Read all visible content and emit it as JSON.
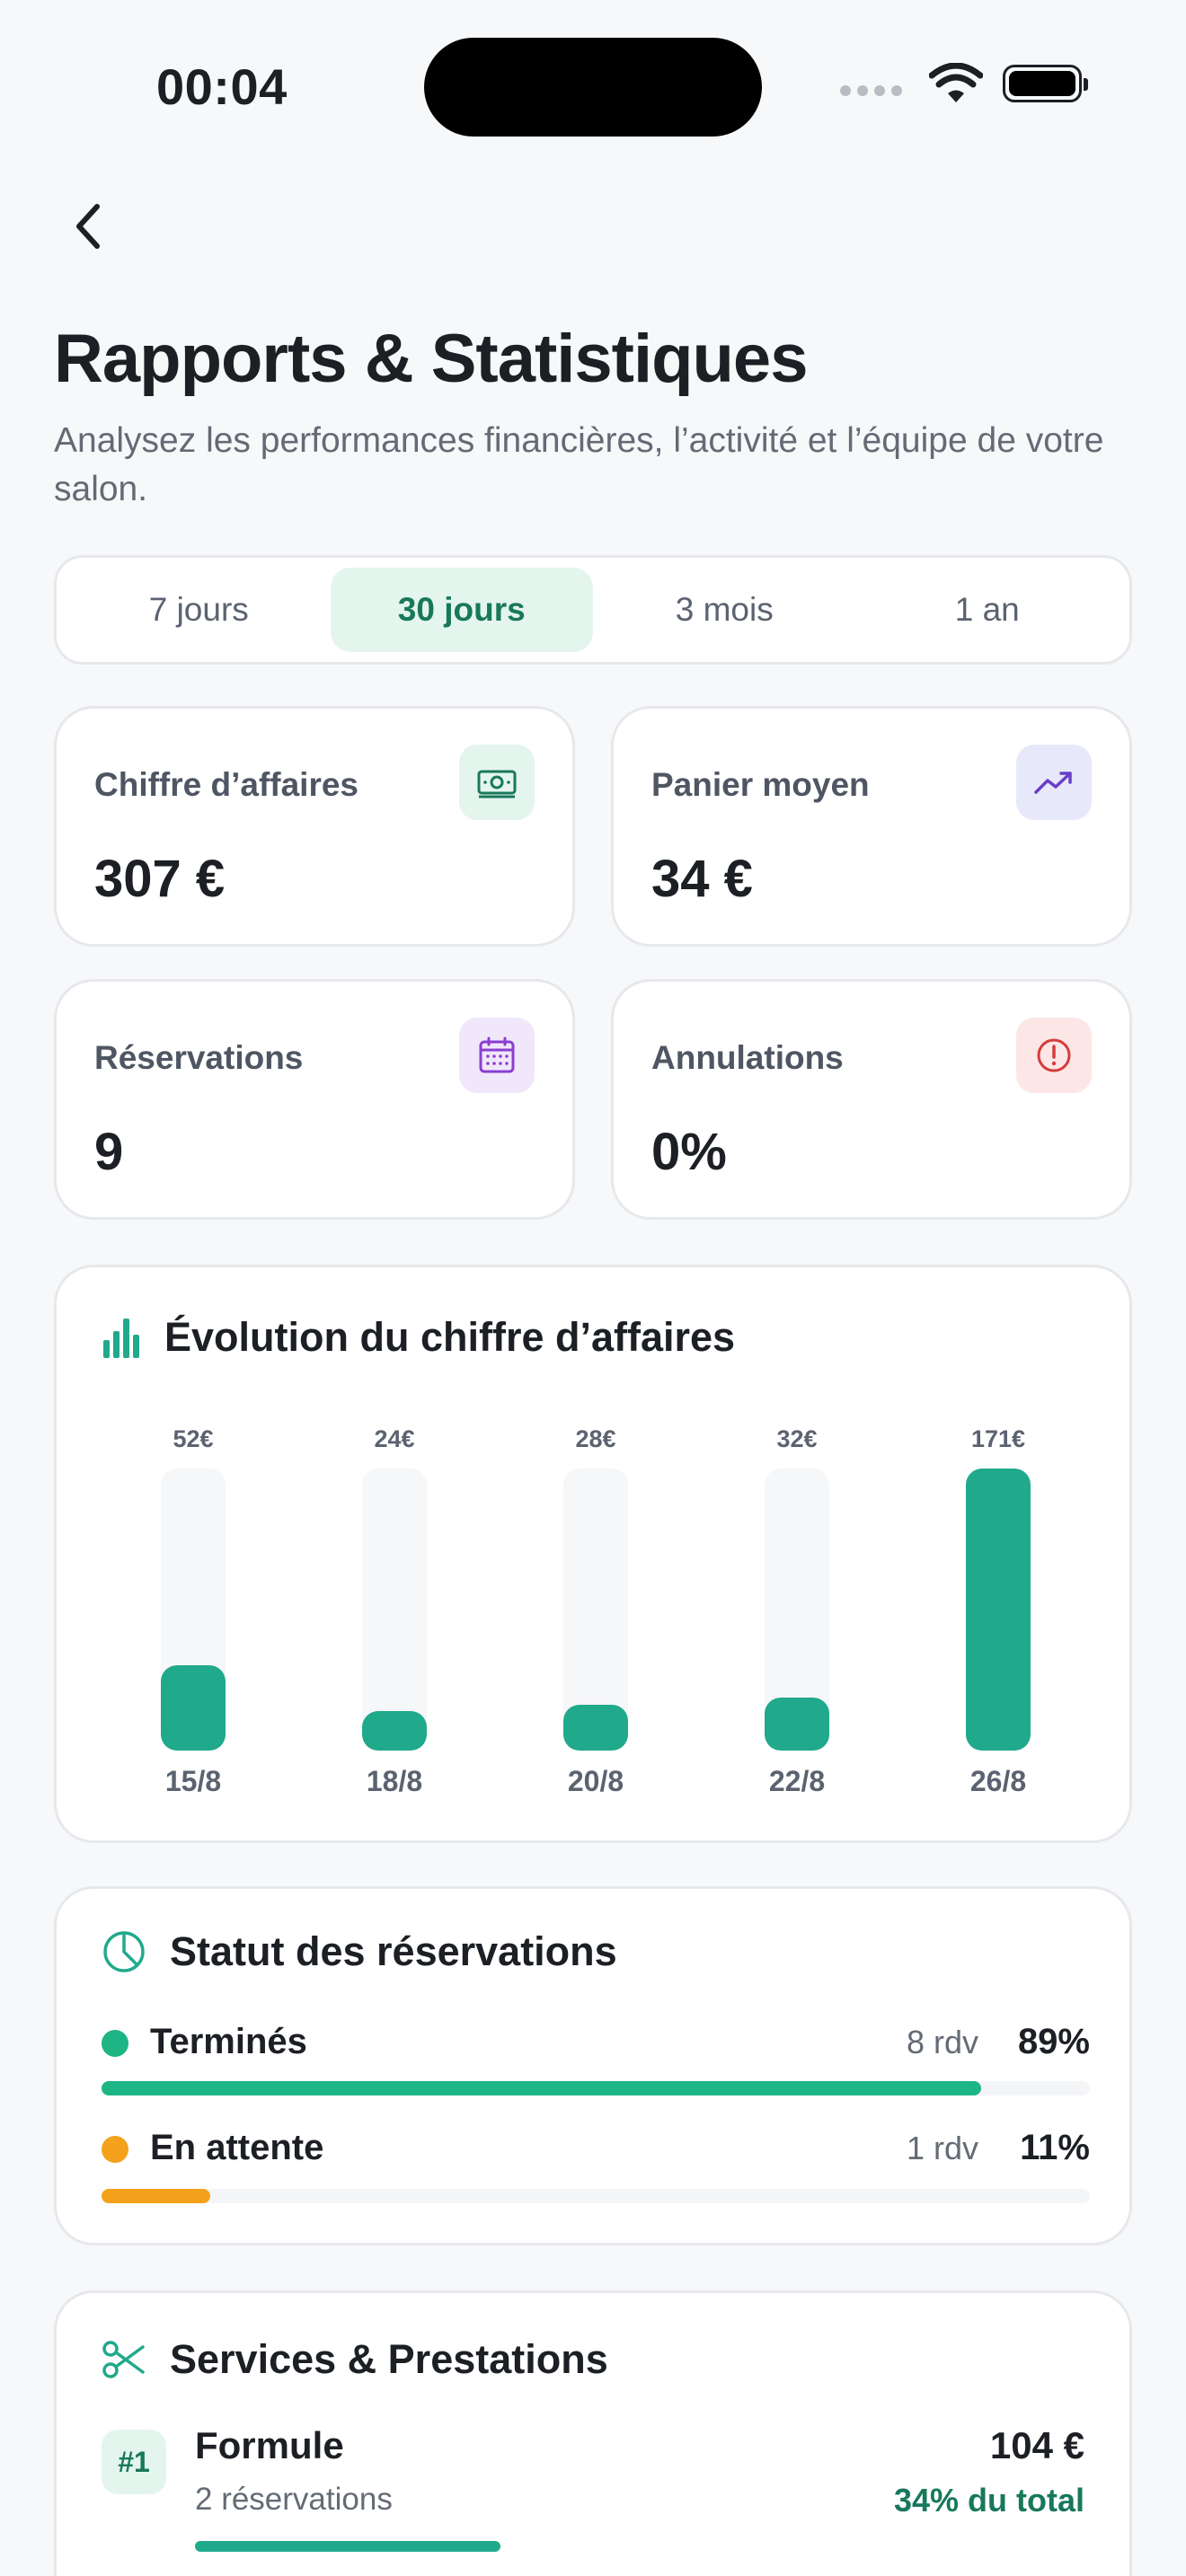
{
  "status_bar": {
    "time": "00:04"
  },
  "header": {
    "title": "Rapports & Statistiques",
    "subtitle": "Analysez les performances financières, l’activité et l’équipe de votre salon."
  },
  "period_tabs": [
    {
      "label": "7 jours",
      "active": false
    },
    {
      "label": "30 jours",
      "active": true
    },
    {
      "label": "3 mois",
      "active": false
    },
    {
      "label": "1 an",
      "active": false
    }
  ],
  "stats": {
    "revenue": {
      "label": "Chiffre d’affaires",
      "value": "307 €",
      "icon": "banknote-icon",
      "icon_bg": "#e4f5ee",
      "icon_color": "#18785b"
    },
    "basket": {
      "label": "Panier moyen",
      "value": "34 €",
      "icon": "trending-up-icon",
      "icon_bg": "#e7e9fb",
      "icon_color": "#6a3fc7"
    },
    "bookings": {
      "label": "Réservations",
      "value": "9",
      "icon": "calendar-icon",
      "icon_bg": "#f1e7fb",
      "icon_color": "#8a3fd1"
    },
    "cancellations": {
      "label": "Annulations",
      "value": "0%",
      "icon": "alert-circle-icon",
      "icon_bg": "#fde6e6",
      "icon_color": "#d43c3c"
    }
  },
  "revenue_chart": {
    "title": "Évolution du chiffre d’affaires",
    "icon": "bar-chart-icon",
    "accent": "#21a98c"
  },
  "chart_data": {
    "type": "bar",
    "categories": [
      "15/8",
      "18/8",
      "20/8",
      "22/8",
      "26/8"
    ],
    "values": [
      52,
      24,
      28,
      32,
      171
    ],
    "value_labels": [
      "52€",
      "24€",
      "28€",
      "32€",
      "171€"
    ],
    "ylim": [
      0,
      171
    ]
  },
  "booking_status": {
    "title": "Statut des réservations",
    "icon": "pie-chart-icon",
    "rows": [
      {
        "name": "Terminés",
        "count": "8 rdv",
        "pct_label": "89%",
        "share": 0.89,
        "color": "#1db584"
      },
      {
        "name": "En attente",
        "count": "1 rdv",
        "pct_label": "11%",
        "share": 0.11,
        "color": "#f4a21b"
      }
    ]
  },
  "services": {
    "title": "Services & Prestations",
    "icon": "scissors-icon",
    "items": [
      {
        "rank": "#1",
        "name": "Formule",
        "bookings": "2 réservations",
        "amount": "104 €",
        "share_label": "34% du total",
        "share": 0.34
      }
    ]
  }
}
